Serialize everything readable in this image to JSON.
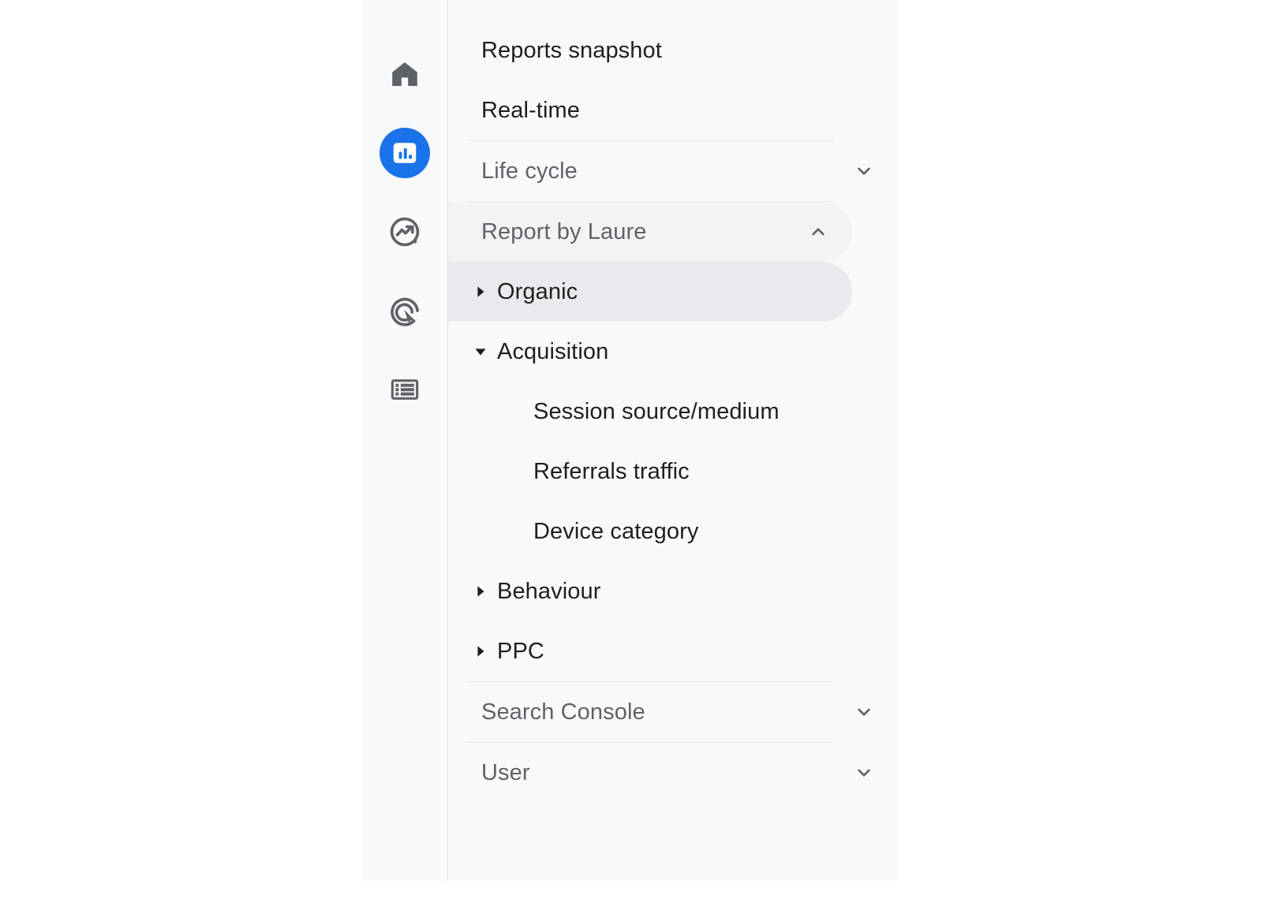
{
  "rail": {
    "items": [
      {
        "icon": "home-icon",
        "name": "home",
        "active": false
      },
      {
        "icon": "reports-bar-chart-icon",
        "name": "reports",
        "active": true
      },
      {
        "icon": "explore-trending-icon",
        "name": "explore",
        "active": false
      },
      {
        "icon": "advertising-target-cursor-icon",
        "name": "advertising",
        "active": false
      },
      {
        "icon": "library-list-icon",
        "name": "library",
        "active": false
      }
    ]
  },
  "nav": {
    "reports_snapshot": "Reports snapshot",
    "real_time": "Real-time",
    "life_cycle": "Life cycle",
    "report_by_laure": "Report by Laure",
    "organic": "Organic",
    "acquisition": "Acquisition",
    "session_source_medium": "Session source/medium",
    "referrals_traffic": "Referrals traffic",
    "device_category": "Device category",
    "behaviour": "Behaviour",
    "ppc": "PPC",
    "search_console": "Search Console",
    "user": "User"
  },
  "colors": {
    "accent": "#1a73e8",
    "panel_bg": "#f8f9fa",
    "selected_bg": "#e8eaed",
    "section_bg": "#f1f3f4",
    "text_primary": "#1f1f21",
    "text_secondary": "#5f6368",
    "divider": "#e3e4e6"
  }
}
